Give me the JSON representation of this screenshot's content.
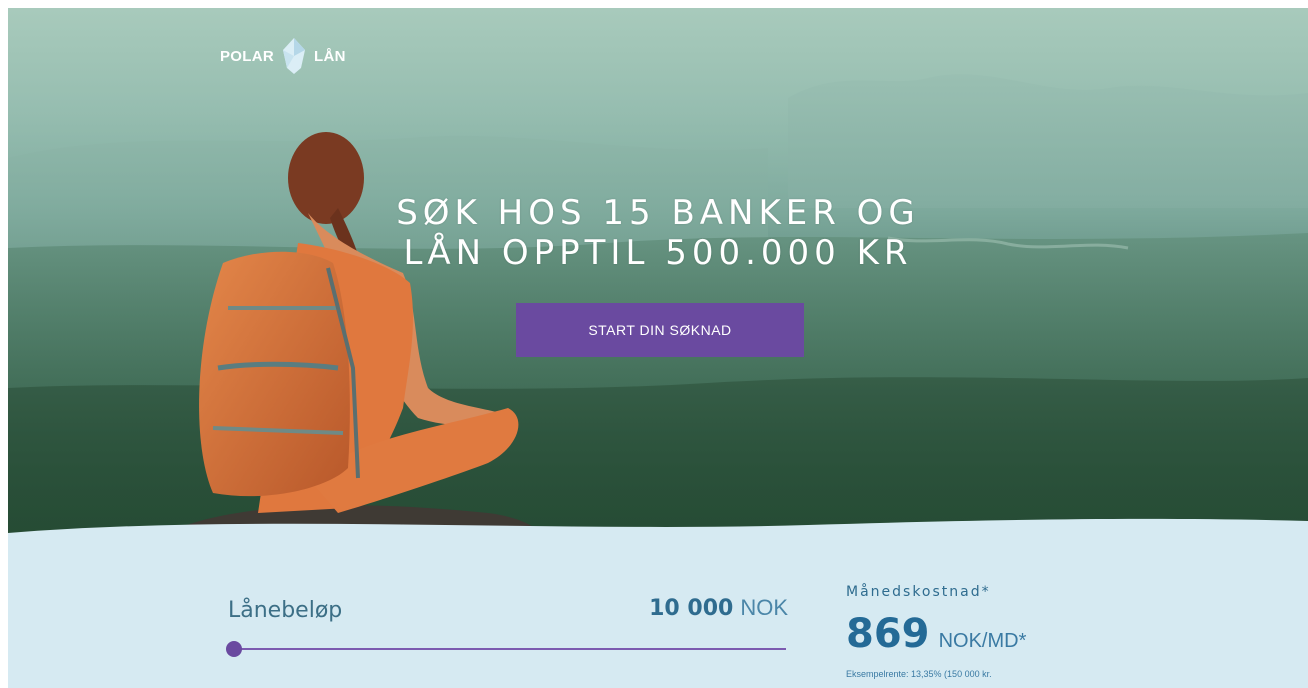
{
  "brand": {
    "left_text": "POLAR",
    "right_text": "LÅN",
    "icon": "iceberg-icon"
  },
  "hero": {
    "headline_line1": "SØK HOS 15 BANKER OG",
    "headline_line2": "LÅN OPPTIL 500.000 KR",
    "cta_label": "START DIN SØKNAD"
  },
  "calculator": {
    "loan_label": "Lånebeløp",
    "loan_amount": "10 000",
    "loan_currency": "NOK",
    "slider_level": 0,
    "monthly_label": "Månedskostnad*",
    "monthly_amount": "869",
    "monthly_unit": "NOK/MD*",
    "example_text": "Eksempelrente: 13,35% (150 000 kr."
  },
  "colors": {
    "accent_purple": "#6a4aa0",
    "panel_bg": "#d6eaf2",
    "text_blue": "#2f6c8f"
  }
}
